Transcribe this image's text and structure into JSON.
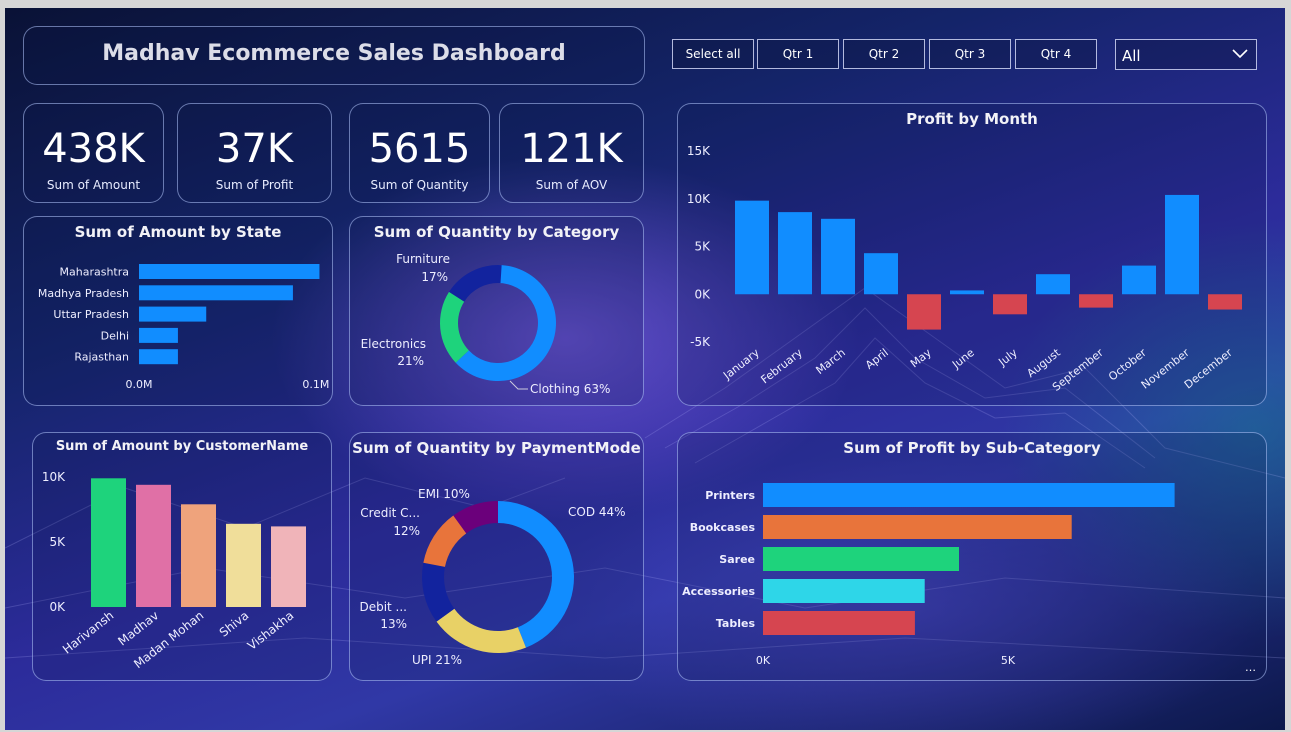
{
  "header": {
    "title": "Madhav Ecommerce Sales Dashboard"
  },
  "slicer": {
    "buttons": [
      "Select all",
      "Qtr 1",
      "Qtr 2",
      "Qtr 3",
      "Qtr 4"
    ],
    "dropdown_value": "All"
  },
  "kpis": [
    {
      "value": "438K",
      "label": "Sum of Amount"
    },
    {
      "value": "37K",
      "label": "Sum of Profit"
    },
    {
      "value": "5615",
      "label": "Sum of Quantity"
    },
    {
      "value": "121K",
      "label": "Sum of AOV"
    }
  ],
  "colors": {
    "blue": "#118dff",
    "red": "#d64550",
    "green": "#1ed37c",
    "orange": "#e8743b",
    "cyan": "#2ed6e8",
    "navy": "#12239e",
    "purple": "#6b007b",
    "yellow": "#e8d166"
  },
  "more_icon": "more-options-icon",
  "chart_data": [
    {
      "id": "state",
      "type": "bar",
      "orientation": "horizontal",
      "title": "Sum of Amount by State",
      "categories": [
        "Maharashtra",
        "Madhya Pradesh",
        "Uttar Pradesh",
        "Delhi",
        "Rajasthan"
      ],
      "values": [
        0.102,
        0.087,
        0.038,
        0.022,
        0.022
      ],
      "xticks": [
        "0.0M",
        "0.1M"
      ],
      "xlim": [
        0,
        0.13
      ],
      "color": "#118dff"
    },
    {
      "id": "category",
      "type": "pie",
      "donut": true,
      "title": "Sum of Quantity by Category",
      "slices": [
        {
          "name": "Clothing",
          "percent": 63,
          "label": "Clothing 63%",
          "color": "#118dff"
        },
        {
          "name": "Electronics",
          "percent": 21,
          "label_name": "Electronics",
          "label_pct": "21%",
          "color": "#1ed37c"
        },
        {
          "name": "Furniture",
          "percent": 17,
          "label_name": "Furniture",
          "label_pct": "17%",
          "color": "#12239e"
        }
      ]
    },
    {
      "id": "month",
      "type": "bar",
      "title": "Profit by Month",
      "categories": [
        "January",
        "February",
        "March",
        "April",
        "May",
        "June",
        "July",
        "August",
        "September",
        "October",
        "November",
        "December"
      ],
      "values": [
        9800,
        8600,
        7900,
        4300,
        -3700,
        400,
        -2100,
        2100,
        -1400,
        3000,
        10400,
        -1600
      ],
      "yticks": [
        "15K",
        "10K",
        "5K",
        "0K",
        "-5K"
      ],
      "ylim": [
        -5000,
        15000
      ],
      "positive_color": "#118dff",
      "negative_color": "#d64550"
    },
    {
      "id": "customer",
      "type": "bar",
      "title": "Sum of Amount by CustomerName",
      "categories": [
        "Harivansh",
        "Madhav",
        "Madan Mohan",
        "Shiva",
        "Vishakha"
      ],
      "values": [
        9900,
        9400,
        7900,
        6400,
        6200
      ],
      "yticks": [
        "10K",
        "5K",
        "0K"
      ],
      "ylim": [
        0,
        10000
      ],
      "colors": [
        "#1ed37c",
        "#e070a6",
        "#efa37c",
        "#f0de9a",
        "#f0b4b9"
      ]
    },
    {
      "id": "payment",
      "type": "pie",
      "donut": true,
      "title": "Sum of Quantity by PaymentMode",
      "slices": [
        {
          "name": "COD",
          "percent": 44,
          "label": "COD 44%",
          "color": "#118dff"
        },
        {
          "name": "UPI",
          "percent": 21,
          "label": "UPI 21%",
          "color": "#e8d166"
        },
        {
          "name": "Debit ...",
          "percent": 13,
          "label_name": "Debit ...",
          "label_pct": "13%",
          "color": "#12239e"
        },
        {
          "name": "Credit C...",
          "percent": 12,
          "label_name": "Credit C...",
          "label_pct": "12%",
          "color": "#e8743b"
        },
        {
          "name": "EMI",
          "percent": 10,
          "label": "EMI 10%",
          "color": "#6b007b"
        }
      ]
    },
    {
      "id": "subcat",
      "type": "bar",
      "orientation": "horizontal",
      "title": "Sum of Profit by Sub-Category",
      "categories": [
        "Printers",
        "Bookcases",
        "Saree",
        "Accessories",
        "Tables"
      ],
      "values": [
        8400,
        6300,
        4000,
        3300,
        3100
      ],
      "xticks": [
        "0K",
        "5K"
      ],
      "xlim": [
        0,
        10000
      ],
      "colors": [
        "#118dff",
        "#e8743b",
        "#1ed37c",
        "#2ed6e8",
        "#d64550"
      ]
    }
  ]
}
